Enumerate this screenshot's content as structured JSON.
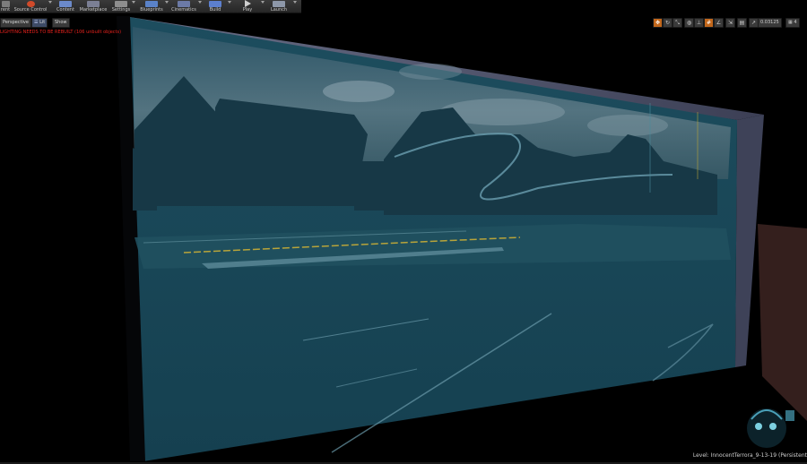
{
  "toolbar": {
    "items": [
      {
        "label": "rent",
        "icon": "save-icon",
        "color": "#8a8a8a"
      },
      {
        "label": "Source Control",
        "icon": "source-control-icon",
        "color": "#d04a2a"
      },
      {
        "label": "Content",
        "icon": "content-icon",
        "color": "#6b89c9"
      },
      {
        "label": "Marketplace",
        "icon": "marketplace-icon",
        "color": "#7b7f94"
      },
      {
        "label": "Settings",
        "icon": "settings-icon",
        "color": "#8e8e8e"
      },
      {
        "label": "Blueprints",
        "icon": "blueprints-icon",
        "color": "#5a82c8"
      },
      {
        "label": "Cinematics",
        "icon": "cinematics-icon",
        "color": "#6c7aa6"
      },
      {
        "label": "Build",
        "icon": "build-icon",
        "color": "#5c7fce"
      },
      {
        "label": "Play",
        "icon": "play-icon",
        "color": "#cfcfcf"
      },
      {
        "label": "Launch",
        "icon": "launch-icon",
        "color": "#8d97a8"
      }
    ]
  },
  "viewport": {
    "perspective_label": "Perspective",
    "lit_label": "Lit",
    "show_label": "Show",
    "warning": "LIGHTING NEEDS TO BE REBUILT (106 unbuilt objects)",
    "camera_speed": "0.03125",
    "grid_value": "4",
    "level_text": "Level:  InnocentTerrora_9-13-19 (Persistent",
    "colors": {
      "glass": "#1c4a5a",
      "sky": "#6f8a96",
      "road_line": "#b8a43a",
      "highlight": "#c2671b",
      "warning": "#e8221c"
    },
    "tools": [
      {
        "icon": "transform-icon",
        "active": true
      },
      {
        "icon": "rotate-icon",
        "active": false
      },
      {
        "icon": "scale-icon",
        "active": false
      },
      {
        "icon": "world-icon",
        "active": false
      },
      {
        "icon": "surface-snap-icon",
        "active": false
      },
      {
        "icon": "grid-snap-icon",
        "active": true
      },
      {
        "icon": "rotation-snap-icon",
        "active": false
      },
      {
        "icon": "scale-snap-icon",
        "active": false
      }
    ]
  }
}
